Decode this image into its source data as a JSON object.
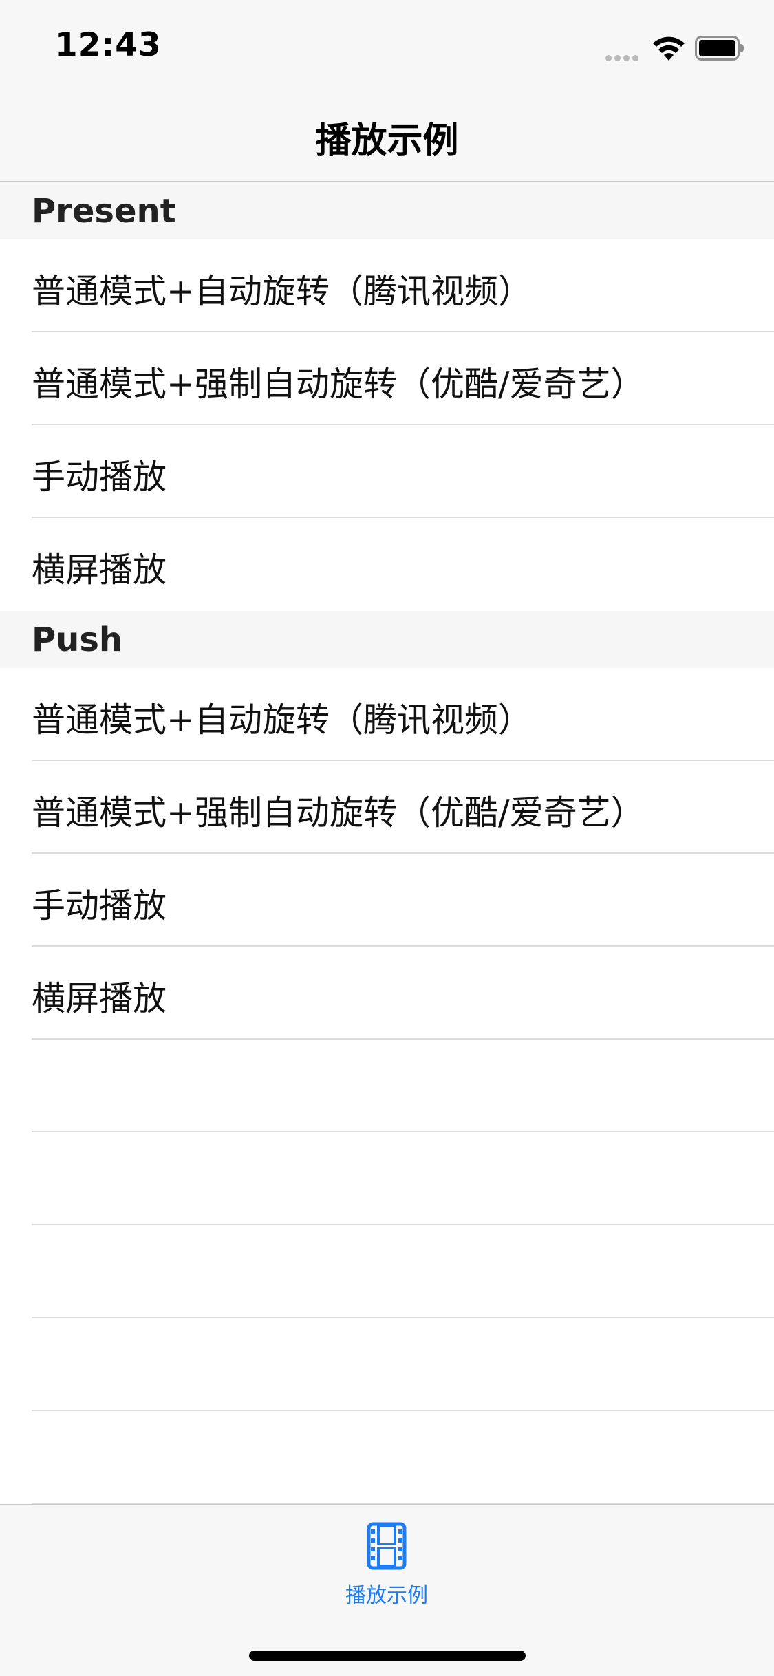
{
  "status_bar": {
    "time": "12:43"
  },
  "nav": {
    "title": "播放示例"
  },
  "sections": [
    {
      "header": "Present",
      "rows": [
        "普通模式+自动旋转（腾讯视频）",
        "普通模式+强制自动旋转（优酷/爱奇艺）",
        "手动播放",
        "横屏播放"
      ]
    },
    {
      "header": "Push",
      "rows": [
        "普通模式+自动旋转（腾讯视频）",
        "普通模式+强制自动旋转（优酷/爱奇艺）",
        "手动播放",
        "横屏播放"
      ]
    }
  ],
  "tab_bar": {
    "items": [
      {
        "label": "播放示例",
        "icon": "film-icon",
        "selected": true
      }
    ]
  },
  "colors": {
    "accent": "#1e7cf2",
    "bar_background": "#f7f7f7",
    "section_header_background": "#f6f6f6",
    "separator": "#dcdcdc"
  }
}
